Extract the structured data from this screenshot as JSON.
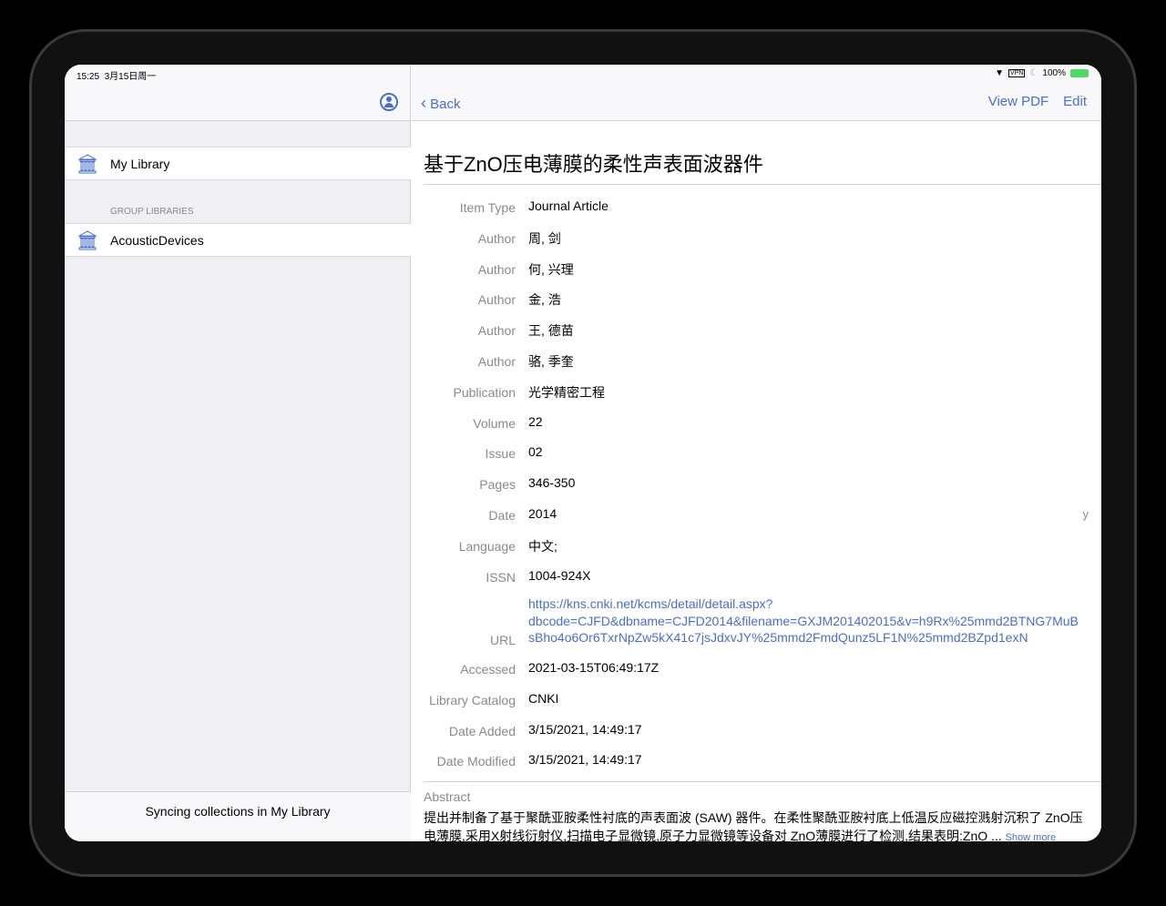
{
  "status": {
    "time": "15:25",
    "date": "3月15日周一",
    "vpn": "VPN",
    "battery": "100%"
  },
  "sidebar": {
    "my_library": "My Library",
    "group_header": "GROUP LIBRARIES",
    "groups": [
      "AcousticDevices"
    ],
    "footer": "Syncing collections in My Library"
  },
  "nav": {
    "back": "Back",
    "view_pdf": "View PDF",
    "edit": "Edit"
  },
  "item": {
    "title": "基于ZnO压电薄膜的柔性声表面波器件",
    "fields": [
      {
        "label": "Item Type",
        "value": "Journal Article"
      },
      {
        "label": "Author",
        "value": "周, 剑"
      },
      {
        "label": "Author",
        "value": "何, 兴理"
      },
      {
        "label": "Author",
        "value": "金, 浩"
      },
      {
        "label": "Author",
        "value": "王, 德苗"
      },
      {
        "label": "Author",
        "value": "骆, 季奎"
      },
      {
        "label": "Publication",
        "value": "光学精密工程"
      },
      {
        "label": "Volume",
        "value": "22"
      },
      {
        "label": "Issue",
        "value": "02"
      },
      {
        "label": "Pages",
        "value": "346-350"
      },
      {
        "label": "Date",
        "value": "2014"
      },
      {
        "label": "Language",
        "value": "中文;"
      },
      {
        "label": "ISSN",
        "value": "1004-924X"
      }
    ],
    "url": {
      "label": "URL",
      "lines": [
        "https://kns.cnki.net/kcms/detail/detail.aspx?",
        "dbcode=CJFD&dbname=CJFD2014&filename=GXJM201402015&v=h9Rx%25mmd2BTNG7MuB",
        "sBho4o6Or6TxrNpZw5kX41c7jsJdxvJY%25mmd2FmdQunz5LF1N%25mmd2BZpd1exN"
      ]
    },
    "fields2": [
      {
        "label": "Accessed",
        "value": "2021-03-15T06:49:17Z"
      },
      {
        "label": "Library Catalog",
        "value": "CNKI"
      },
      {
        "label": "Date Added",
        "value": "3/15/2021, 14:49:17"
      },
      {
        "label": "Date Modified",
        "value": "3/15/2021, 14:49:17"
      }
    ],
    "date_suffix": "y",
    "abstract_label": "Abstract",
    "abstract": "提出并制备了基于聚酰亚胺柔性衬底的声表面波 (SAW) 器件。在柔性聚酰亚胺衬底上低温反应磁控溅射沉积了 ZnO压电薄膜,采用X射线衍射仪,扫描电子显微镜,原子力显微镜等设备对 ZnO薄膜进行了检测,结果表明:ZnO ...",
    "show_more": "Show more"
  },
  "colors": {
    "accent": "#4a6fc9"
  }
}
